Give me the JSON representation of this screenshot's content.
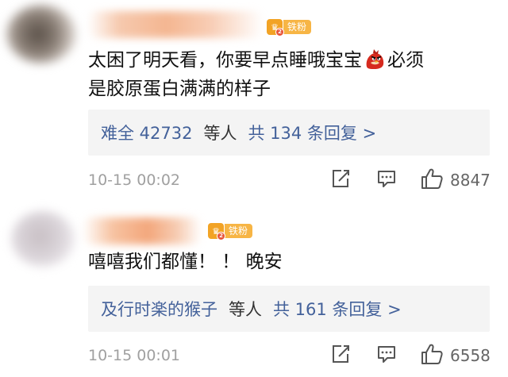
{
  "comments": [
    {
      "badge": {
        "label": "铁粉",
        "level": "2"
      },
      "text_line1_before_emoji": "太困了明天看，你要早点睡哦宝宝",
      "emoji": "angry-bird-emoji",
      "text_line1_after_emoji": "必须",
      "text_line2": "是胶原蛋白满满的样子",
      "replies": {
        "user_count": "难全 42732",
        "users_suffix": "等人",
        "total": "共 134 条回复 >"
      },
      "timestamp": "10-15 00:02",
      "likes": "8847"
    },
    {
      "badge": {
        "label": "铁粉",
        "level": "2"
      },
      "text_line1": "嘻嘻我们都懂！ ！ 晚安",
      "replies": {
        "user_count": "及行时楽的猴子",
        "users_suffix": "等人",
        "total": "共 161 条回复 >"
      },
      "timestamp": "10-15 00:01",
      "likes": "6558"
    }
  ],
  "icons": {
    "share": "share-icon",
    "comment": "comment-icon",
    "like": "thumbs-up-icon"
  },
  "colors": {
    "link_blue": "#43619a",
    "badge_orange": "#f7b545",
    "muted_gray": "#a0a0a0",
    "reply_bg": "#f4f4f4"
  }
}
